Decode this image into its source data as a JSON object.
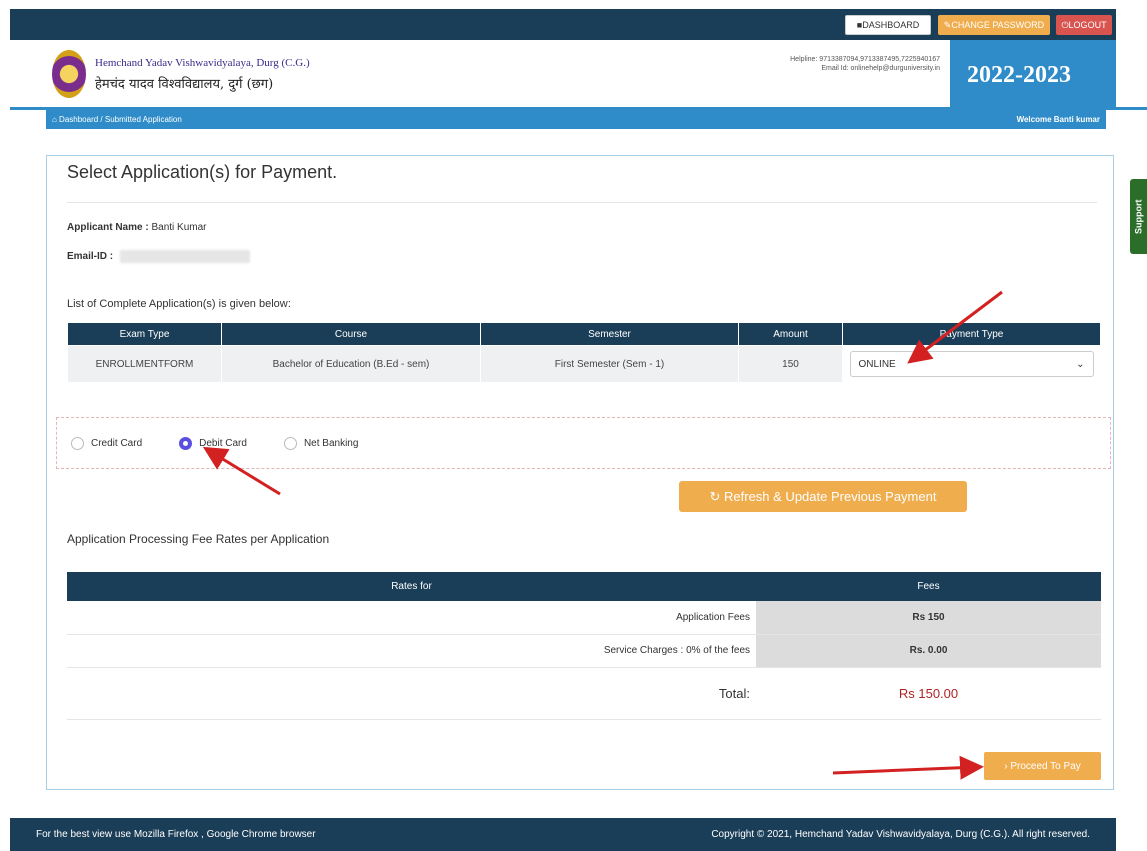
{
  "topnav": {
    "dashboard": "■DASHBOARD",
    "change_password": "✎CHANGE PASSWORD",
    "logout": "⏻LOGOUT"
  },
  "header": {
    "university_en": "Hemchand Yadav Vishwavidyalaya, Durg (C.G.)",
    "university_hi": "हेमचंद यादव विश्वविद्यालय, दुर्ग (छग)",
    "helpline": "Helpline: 9713387094,9713387495,7225940167",
    "email": "Email Id: onlinehelp@durguniversity.in",
    "session": "2022-2023"
  },
  "breadcrumb": {
    "home": "⌂ Dashboard",
    "sep": " / ",
    "current": "Submitted Application",
    "welcome": "Welcome Banti kumar"
  },
  "support": "Support",
  "page": {
    "title": "Select Application(s) for Payment.",
    "applicant_label": "Applicant Name :",
    "applicant_name": "Banti Kumar",
    "email_label": "Email-ID :",
    "list_label": "List of Complete Application(s) is given below:"
  },
  "apps_table": {
    "headers": [
      "Exam Type",
      "Course",
      "Semester",
      "Amount",
      "Payment Type"
    ],
    "row": {
      "exam_type": "ENROLLMENTFORM",
      "course": "Bachelor of Education (B.Ed - sem)",
      "semester": "First Semester (Sem - 1)",
      "amount": "150",
      "payment_type": "ONLINE"
    }
  },
  "payment_methods": [
    "Credit Card",
    "Debit Card",
    "Net Banking"
  ],
  "selected_method": "Debit Card",
  "refresh_button": "↻ Refresh & Update Previous Payment",
  "fees": {
    "label": "Application Processing Fee Rates per Application",
    "headers": [
      "Rates for",
      "Fees"
    ],
    "rows": [
      {
        "label": "Application Fees",
        "value": "Rs 150"
      },
      {
        "label": "Service Charges : 0% of the fees",
        "value": "Rs. 0.00"
      }
    ],
    "total_label": "Total:",
    "total_value": "Rs 150.00"
  },
  "proceed_button": "› Proceed To Pay",
  "footer": {
    "left": "For the best view use Mozilla Firefox , Google Chrome browser",
    "right": "Copyright © 2021, Hemchand Yadav Vishwavidyalaya, Durg (C.G.). All right reserved."
  },
  "colors": {
    "navy": "#1b3e58",
    "blue": "#2f8cc9",
    "orange": "#f0ad4e",
    "red": "#d9534f",
    "arrow": "#d32020"
  }
}
